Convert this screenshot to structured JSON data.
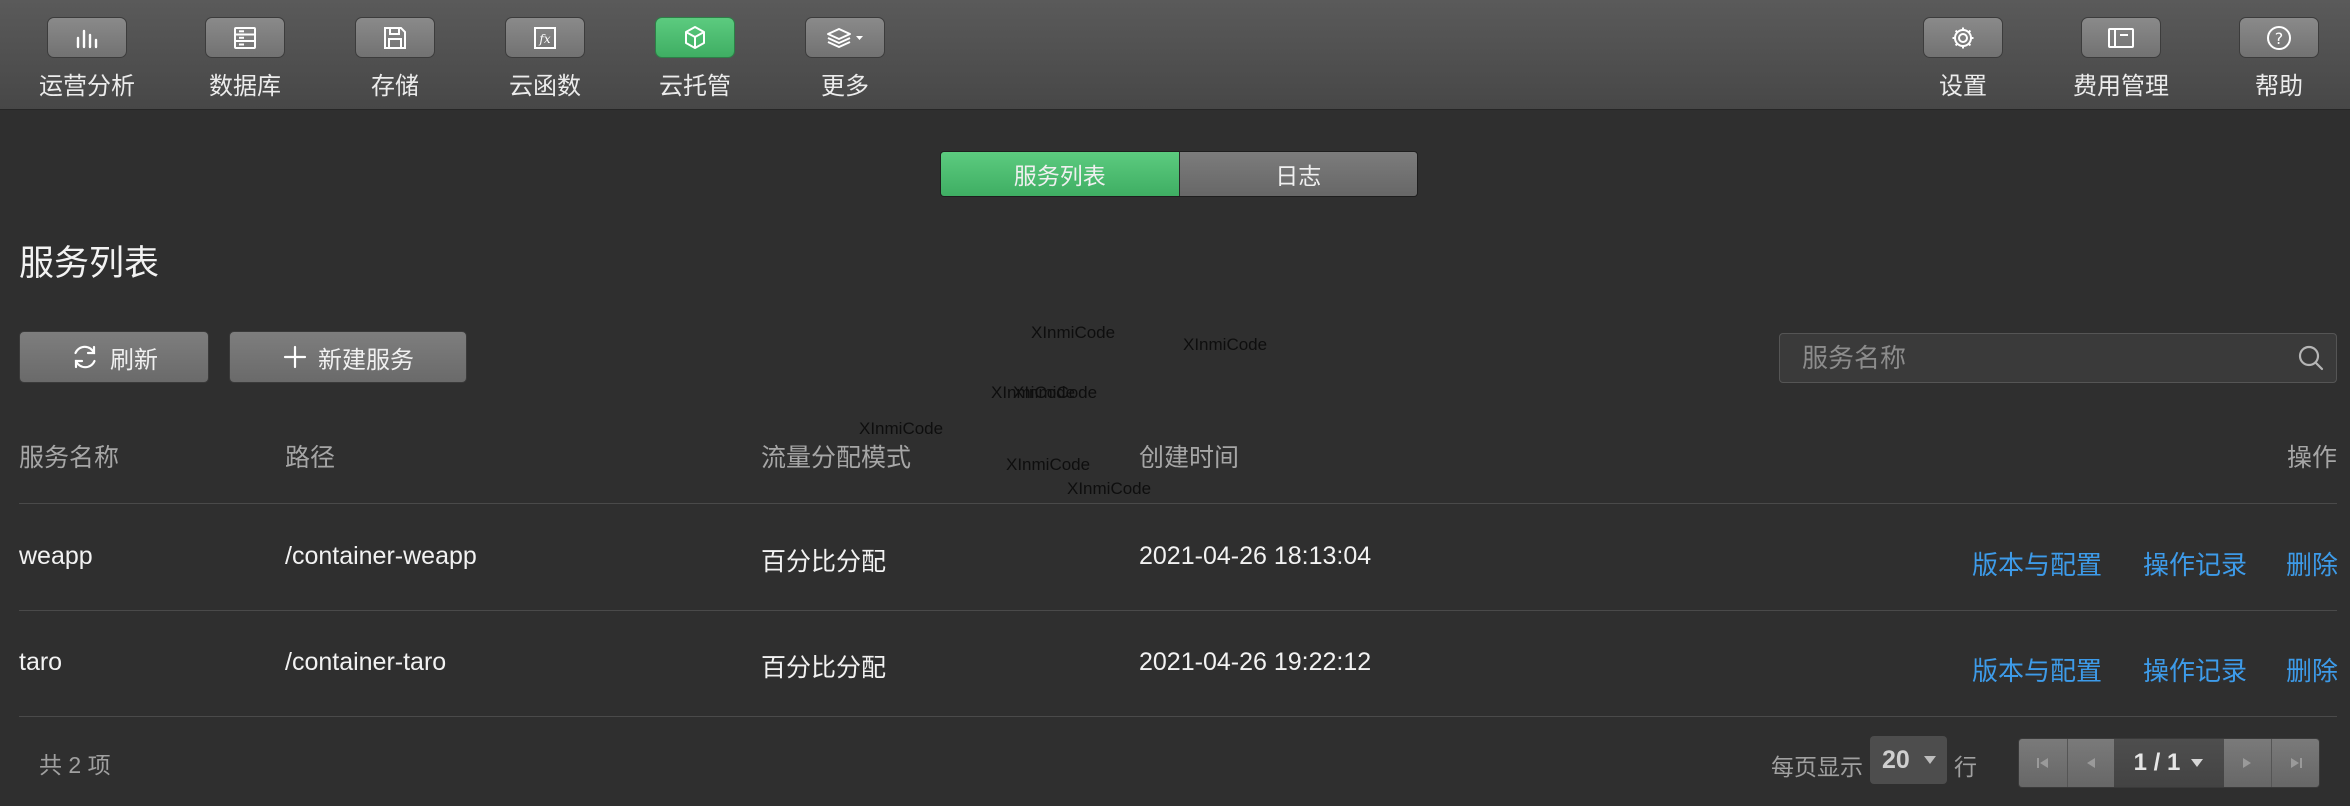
{
  "toolbar": {
    "left": [
      {
        "label": "运营分析",
        "icon": "bar-chart-icon",
        "active": false
      },
      {
        "label": "数据库",
        "icon": "database-icon",
        "active": false
      },
      {
        "label": "存储",
        "icon": "save-icon",
        "active": false
      },
      {
        "label": "云函数",
        "icon": "function-icon",
        "active": false
      },
      {
        "label": "云托管",
        "icon": "cube-icon",
        "active": true
      },
      {
        "label": "更多",
        "icon": "layers-icon",
        "active": false
      }
    ],
    "right": [
      {
        "label": "设置",
        "icon": "gear-icon"
      },
      {
        "label": "费用管理",
        "icon": "billing-icon"
      },
      {
        "label": "帮助",
        "icon": "help-icon"
      }
    ]
  },
  "tabs": [
    {
      "label": "服务列表",
      "active": true
    },
    {
      "label": "日志",
      "active": false
    }
  ],
  "page_title": "服务列表",
  "actions": {
    "refresh": "刷新",
    "new_service": "新建服务"
  },
  "search": {
    "placeholder": "服务名称",
    "value": ""
  },
  "watermark_text": "XInmiCode",
  "table": {
    "headers": {
      "name": "服务名称",
      "path": "路径",
      "mode": "流量分配模式",
      "created": "创建时间",
      "ops": "操作"
    },
    "rows": [
      {
        "name": "weapp",
        "path": "/container-weapp",
        "mode": "百分比分配",
        "created": "2021-04-26 18:13:04"
      },
      {
        "name": "taro",
        "path": "/container-taro",
        "mode": "百分比分配",
        "created": "2021-04-26 19:22:12"
      }
    ],
    "row_actions": {
      "version": "版本与配置",
      "log": "操作记录",
      "delete": "删除"
    }
  },
  "footer": {
    "total": "共 2 项",
    "per_page_label": "每页显示",
    "per_page_value": "20",
    "row_unit": "行",
    "page": "1 / 1"
  },
  "colors": {
    "accent_green": "#4cbf70",
    "link_blue": "#3d9be9",
    "background": "#2f2f2f"
  }
}
